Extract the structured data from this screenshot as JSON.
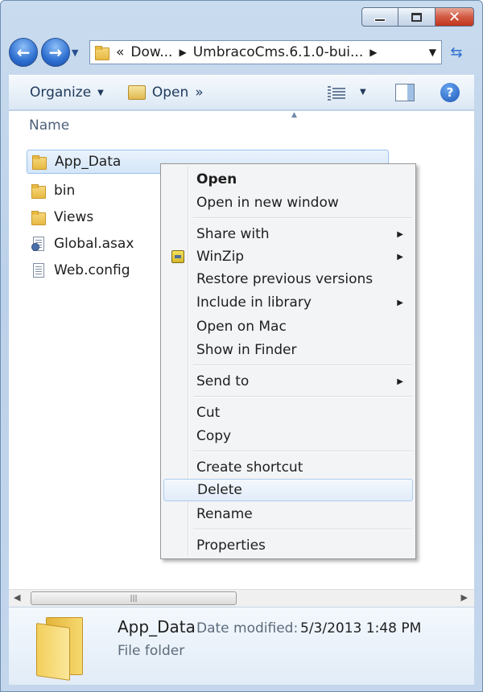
{
  "window": {
    "caption_buttons": {
      "close_glyph": "✕"
    }
  },
  "navbar": {
    "back_glyph": "←",
    "forward_glyph": "→",
    "address": {
      "overflow": "«",
      "crumbs": [
        "Dow...",
        "UmbracoCms.6.1.0-bui..."
      ]
    }
  },
  "toolbar": {
    "organize_label": "Organize",
    "open_label": "Open",
    "more_glyph": "»",
    "help_glyph": "?"
  },
  "file_list": {
    "column_header": "Name",
    "items": [
      {
        "label": "App_Data",
        "icon": "folder-icon",
        "selected": true
      },
      {
        "label": "bin",
        "icon": "folder-icon"
      },
      {
        "label": "Views",
        "icon": "folder-icon"
      },
      {
        "label": "Global.asax",
        "icon": "asax-file-icon"
      },
      {
        "label": "Web.config",
        "icon": "config-file-icon"
      }
    ]
  },
  "context_menu": {
    "items": [
      {
        "label": "Open",
        "bold": true
      },
      {
        "label": "Open in new window"
      },
      {
        "label": "Share with",
        "submenu": true
      },
      {
        "label": "WinZip",
        "submenu": true,
        "icon": "winzip-icon"
      },
      {
        "label": "Restore previous versions"
      },
      {
        "label": "Include in library",
        "submenu": true
      },
      {
        "label": "Open on Mac"
      },
      {
        "label": "Show in Finder"
      },
      {
        "label": "Send to",
        "submenu": true
      },
      {
        "label": "Cut"
      },
      {
        "label": "Copy"
      },
      {
        "label": "Create shortcut"
      },
      {
        "label": "Delete",
        "hover": true
      },
      {
        "label": "Rename"
      },
      {
        "label": "Properties"
      }
    ]
  },
  "scrollbar": {
    "thumb_grip": "|||"
  },
  "details": {
    "name": "App_Data",
    "modified_label": "Date modified:",
    "modified_value": "5/3/2013 1:48 PM",
    "type": "File folder"
  }
}
